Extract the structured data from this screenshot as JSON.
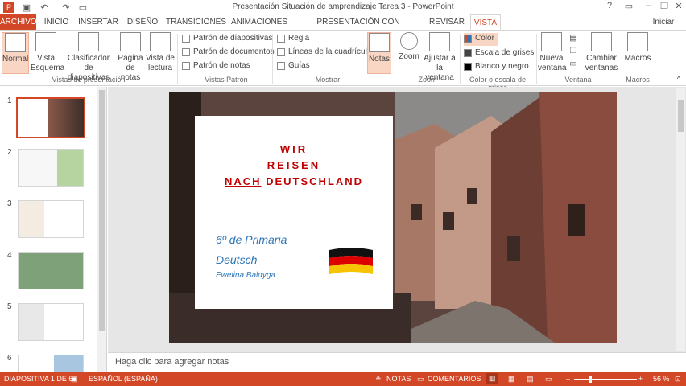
{
  "window": {
    "title": "Presentación Situación de amprendizaje Tarea 3 - PowerPoint",
    "sign_in": "Iniciar sesión"
  },
  "tabs": [
    "ARCHIVO",
    "INICIO",
    "INSERTAR",
    "DISEÑO",
    "TRANSICIONES",
    "ANIMACIONES",
    "PRESENTACIÓN CON DIAPOSITIVAS",
    "REVISAR",
    "VISTA"
  ],
  "ribbon": {
    "normal": "Normal",
    "esquema": "Vista Esquema",
    "clasificador": "Clasificador de diapositivas",
    "pagina_notas": "Página de notas",
    "vista_lectura": "Vista de lectura",
    "group_presentacion": "Vistas de presentación",
    "patron_diapositivas": "Patrón de diapositivas",
    "patron_documentos": "Patrón de documentos",
    "patron_notas": "Patrón de notas",
    "group_patron": "Vistas Patrón",
    "regla": "Regla",
    "lineas_cuadricula": "Líneas de la cuadrícula",
    "guias": "Guías",
    "group_mostrar": "Mostrar",
    "notas": "Notas",
    "zoom": "Zoom",
    "ajustar": "Ajustar a la ventana",
    "group_zoom": "Zoom",
    "color": "Color",
    "escala_grises": "Escala de grises",
    "blanco_negro": "Blanco y negro",
    "group_color": "Color o escala de grises",
    "nueva_ventana": "Nueva ventana",
    "cambiar_ventanas": "Cambiar ventanas",
    "group_ventana": "Ventana",
    "macros": "Macros",
    "group_macros": "Macros"
  },
  "thumbnails": [
    "1",
    "2",
    "3",
    "4",
    "5",
    "6"
  ],
  "slide": {
    "line1": "WIR",
    "line2": "REISEN",
    "line3a": "NACH",
    "line3b": " DEUTSCHLAND",
    "grade": "6º de Primaria",
    "subject": "Deutsch",
    "author": "Ewelina Baldyga"
  },
  "notes_placeholder": "Haga clic para agregar notas",
  "status": {
    "slide_info": "DIAPOSITIVA 1 DE 6",
    "language": "ESPAÑOL (ESPAÑA)",
    "notes_btn": "NOTAS",
    "comments_btn": "COMENTARIOS",
    "zoom": "56 %"
  },
  "colors": {
    "accent": "#d24726",
    "slide_title": "#c00000",
    "slide_subtitle": "#2e75b6"
  }
}
